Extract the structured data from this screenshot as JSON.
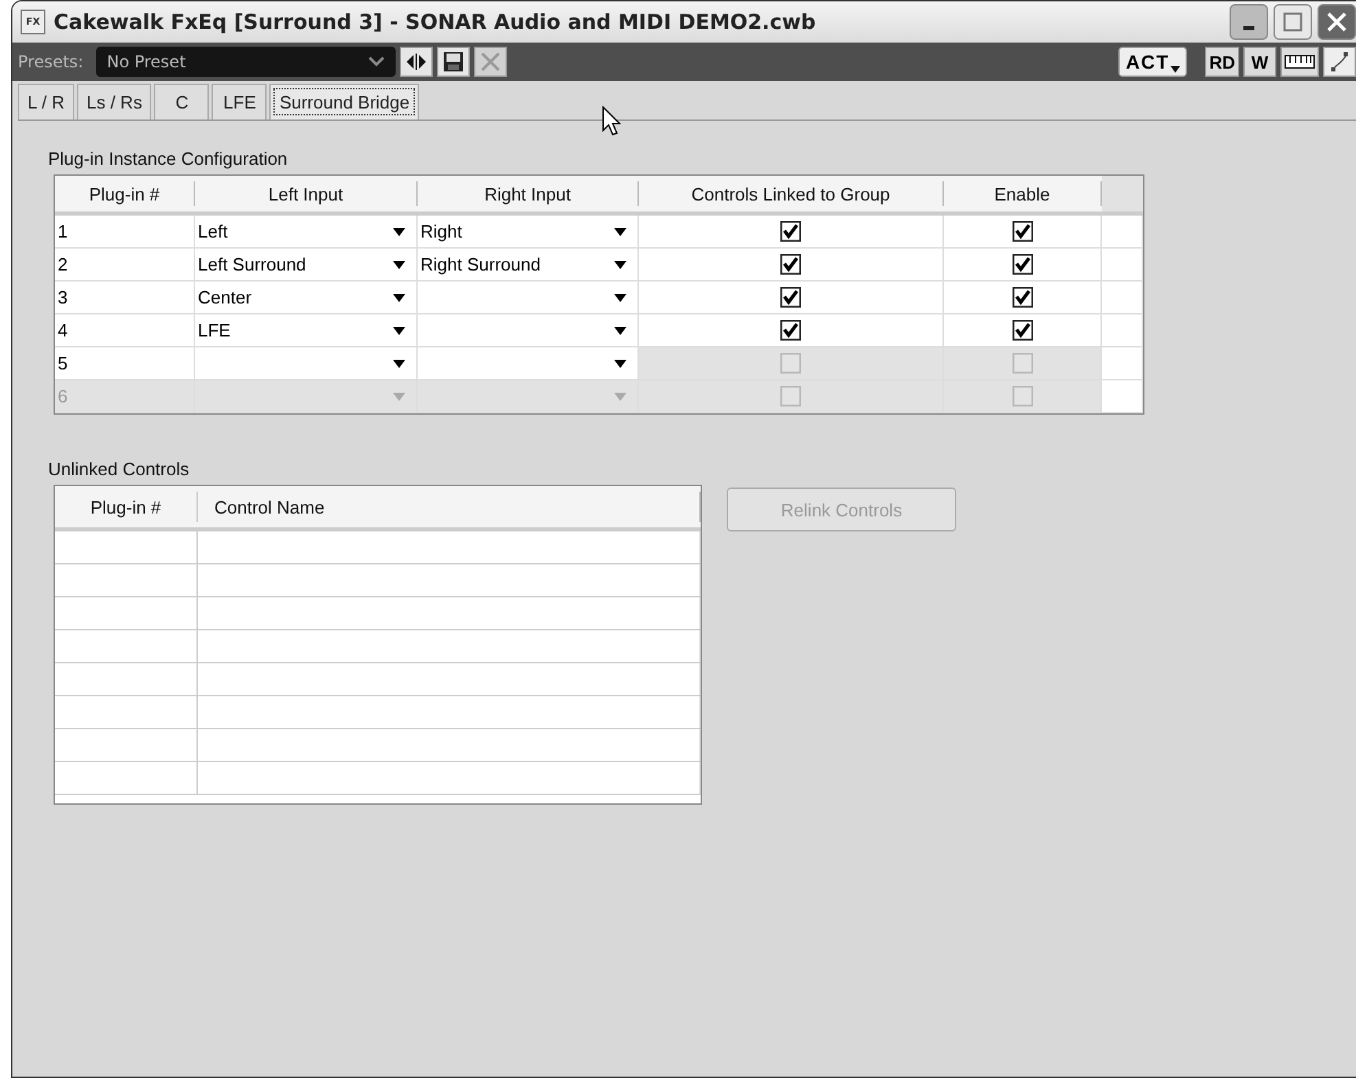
{
  "window": {
    "title": "Cakewalk FxEq [Surround 3] - SONAR Audio and MIDI DEMO2.cwb",
    "icon_text": "FX"
  },
  "presets": {
    "label": "Presets:",
    "value": "No Preset"
  },
  "toolbar": {
    "act_label": "ACT",
    "rd_label": "RD",
    "w_label": "W"
  },
  "tabs": [
    {
      "label": "L / R",
      "selected": false
    },
    {
      "label": "Ls / Rs",
      "selected": false
    },
    {
      "label": "C",
      "selected": false
    },
    {
      "label": "LFE",
      "selected": false
    },
    {
      "label": "Surround Bridge",
      "selected": true
    }
  ],
  "config": {
    "title": "Plug-in Instance Configuration",
    "columns": [
      "Plug-in #",
      "Left Input",
      "Right Input",
      "Controls Linked to Group",
      "Enable"
    ],
    "rows": [
      {
        "number": "1",
        "left_input": "Left",
        "right_input": "Right",
        "disabled": false,
        "linked": {
          "checked": true,
          "disabled": false
        },
        "enable": {
          "checked": true,
          "disabled": false
        }
      },
      {
        "number": "2",
        "left_input": "Left Surround",
        "right_input": "Right Surround",
        "disabled": false,
        "linked": {
          "checked": true,
          "disabled": false
        },
        "enable": {
          "checked": true,
          "disabled": false
        }
      },
      {
        "number": "3",
        "left_input": "Center",
        "right_input": "",
        "disabled": false,
        "linked": {
          "checked": true,
          "disabled": false
        },
        "enable": {
          "checked": true,
          "disabled": false
        }
      },
      {
        "number": "4",
        "left_input": "LFE",
        "right_input": "",
        "disabled": false,
        "linked": {
          "checked": true,
          "disabled": false
        },
        "enable": {
          "checked": true,
          "disabled": false
        }
      },
      {
        "number": "5",
        "left_input": "",
        "right_input": "",
        "disabled": false,
        "linked": {
          "checked": false,
          "disabled": true
        },
        "enable": {
          "checked": false,
          "disabled": true
        }
      },
      {
        "number": "6",
        "left_input": "",
        "right_input": "",
        "disabled": true,
        "linked": {
          "checked": false,
          "disabled": true
        },
        "enable": {
          "checked": false,
          "disabled": true
        }
      }
    ]
  },
  "unlinked": {
    "title": "Unlinked Controls",
    "columns": [
      "Plug-in #",
      "Control Name"
    ]
  },
  "relink_button": {
    "label": "Relink Controls",
    "disabled": true
  }
}
